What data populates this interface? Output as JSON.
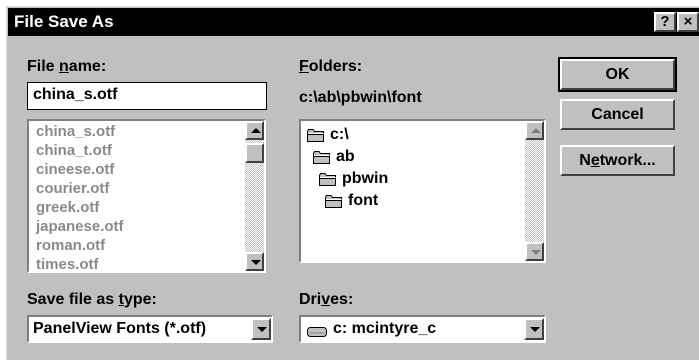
{
  "window": {
    "title": "File Save As",
    "help_label": "?",
    "close_label": "×"
  },
  "file_name": {
    "label_pre": "File ",
    "label_hot": "n",
    "label_post": "ame:",
    "value": "china_s.otf",
    "files": [
      "china_s.otf",
      "china_t.otf",
      "cineese.otf",
      "courier.otf",
      "greek.otf",
      "japanese.otf",
      "roman.otf",
      "times.otf"
    ]
  },
  "folders": {
    "label_hot": "F",
    "label_post": "olders:",
    "current_path": "c:\\ab\\pbwin\\font",
    "tree": [
      "c:\\",
      "ab",
      "pbwin",
      "font"
    ]
  },
  "save_type": {
    "label_pre": "Save file as ",
    "label_hot": "t",
    "label_post": "ype:",
    "value": "PanelView Fonts (*.otf)"
  },
  "drives": {
    "label_pre": "Dri",
    "label_hot": "v",
    "label_post": "es:",
    "value": "c: mcintyre_c"
  },
  "buttons": {
    "ok": "OK",
    "cancel": "Cancel",
    "network_pre": "N",
    "network_hot": "e",
    "network_post": "twork..."
  },
  "colors": {
    "dialog_bg": "#c0c0c0",
    "titlebar_bg": "#000000",
    "list_text_disabled": "#8a8a8a"
  }
}
